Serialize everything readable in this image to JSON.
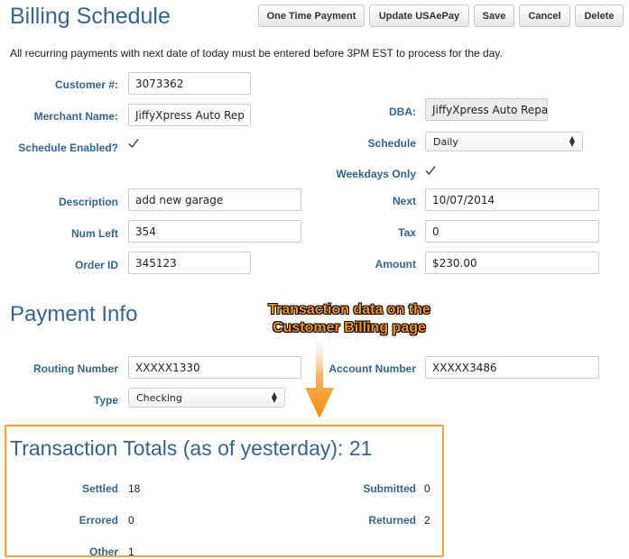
{
  "header": {
    "title": "Billing Schedule",
    "buttons": {
      "one_time_payment": "One Time Payment",
      "update_usaepay": "Update USAePay",
      "save": "Save",
      "cancel": "Cancel",
      "delete": "Delete"
    }
  },
  "notice": "All recurring payments with next date of today must be entered before 3PM EST to process for the day.",
  "billing": {
    "customer_no": {
      "label": "Customer #:",
      "value": "3073362"
    },
    "merchant_name": {
      "label": "Merchant Name:",
      "value": "JiffyXpress Auto Rep"
    },
    "dba": {
      "label": "DBA:",
      "value": "JiffyXpress Auto Repa"
    },
    "schedule_enabled": {
      "label": "Schedule Enabled?",
      "checked": true
    },
    "schedule": {
      "label": "Schedule",
      "value": "Daily"
    },
    "weekdays_only": {
      "label": "Weekdays Only",
      "checked": true
    },
    "description": {
      "label": "Description",
      "value": "add new garage"
    },
    "next": {
      "label": "Next",
      "value": "10/07/2014"
    },
    "num_left": {
      "label": "Num Left",
      "value": "354"
    },
    "tax": {
      "label": "Tax",
      "value": "0"
    },
    "order_id": {
      "label": "Order ID",
      "value": "345123"
    },
    "amount": {
      "label": "Amount",
      "value": "$230.00"
    }
  },
  "payment": {
    "title": "Payment Info",
    "routing_number": {
      "label": "Routing Number",
      "value": "XXXXX1330"
    },
    "account_number": {
      "label": "Account Number",
      "value": "XXXXX3486"
    },
    "type": {
      "label": "Type",
      "value": "Checking"
    }
  },
  "annotation": {
    "line1": "Transaction data on the",
    "line2": "Customer Billing page",
    "color": "#f7921e"
  },
  "totals": {
    "title": "Transaction Totals (as of yesterday): 21",
    "settled": {
      "label": "Settled",
      "value": "18"
    },
    "submitted": {
      "label": "Submitted",
      "value": "0"
    },
    "errored": {
      "label": "Errored",
      "value": "0"
    },
    "returned": {
      "label": "Returned",
      "value": "2"
    },
    "other": {
      "label": "Other",
      "value": "1"
    }
  },
  "colors": {
    "heading": "#35648f",
    "label": "#35648f",
    "highlight_border": "#f7a13c"
  }
}
